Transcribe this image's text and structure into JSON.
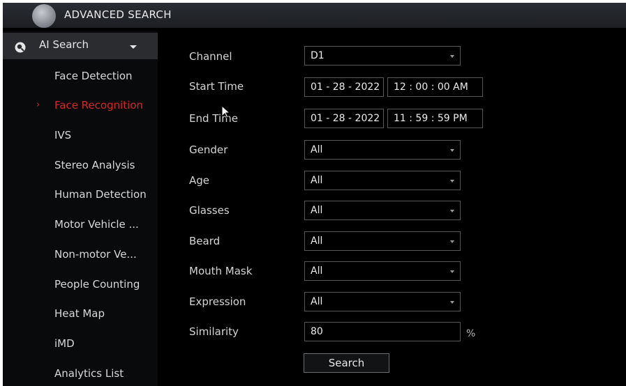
{
  "header": {
    "title": "ADVANCED SEARCH"
  },
  "sidebar": {
    "section_label": "AI Search",
    "items": [
      {
        "label": "Face Detection"
      },
      {
        "label": "Face Recognition",
        "active": true
      },
      {
        "label": "IVS"
      },
      {
        "label": "Stereo Analysis"
      },
      {
        "label": "Human Detection"
      },
      {
        "label": "Motor Vehicle ..."
      },
      {
        "label": "Non-motor Ve..."
      },
      {
        "label": "People Counting"
      },
      {
        "label": "Heat Map"
      },
      {
        "label": "iMD"
      },
      {
        "label": "Analytics List"
      }
    ]
  },
  "form": {
    "channel": {
      "label": "Channel",
      "value": "D1"
    },
    "start_time": {
      "label": "Start Time",
      "date": "01 - 28 - 2022",
      "time": "12 : 00 : 00 AM"
    },
    "end_time": {
      "label": "End Time",
      "date": "01 - 28 - 2022",
      "time": "11 : 59 : 59 PM"
    },
    "gender": {
      "label": "Gender",
      "value": "All"
    },
    "age": {
      "label": "Age",
      "value": "All"
    },
    "glasses": {
      "label": "Glasses",
      "value": "All"
    },
    "beard": {
      "label": "Beard",
      "value": "All"
    },
    "mouth_mask": {
      "label": "Mouth Mask",
      "value": "All"
    },
    "expression": {
      "label": "Expression",
      "value": "All"
    },
    "similarity": {
      "label": "Similarity",
      "value": "80",
      "unit": "%"
    },
    "search_button": "Search"
  },
  "colors": {
    "accent_red": "#d4262b",
    "background": "#000000",
    "header": "#2a2d33"
  }
}
